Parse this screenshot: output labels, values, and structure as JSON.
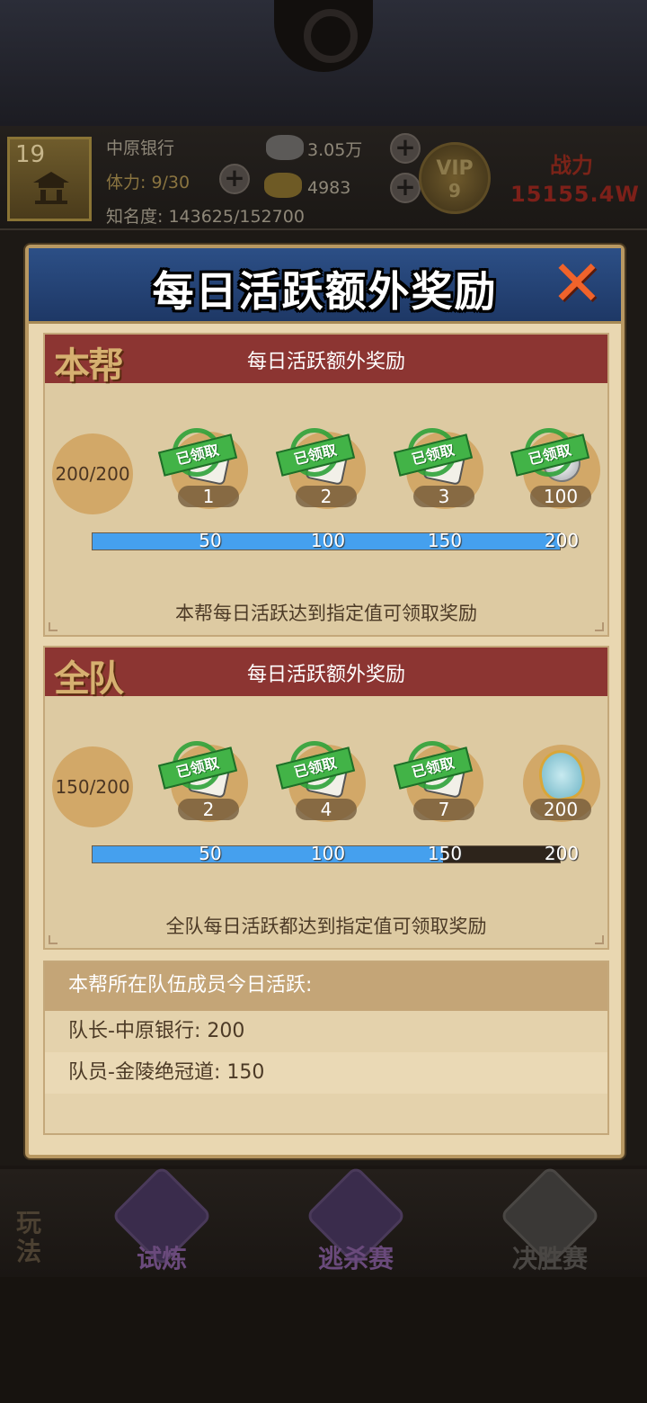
{
  "topbar": {
    "level": "19",
    "player_name": "中原银行",
    "stamina": "体力: 9/30",
    "fame": "知名度: 143625/152700",
    "silver": "3.05万",
    "gold": "4983",
    "vip_label": "VIP",
    "vip_level": "9",
    "power_label": "战力",
    "power_value": "15155.4W"
  },
  "modal": {
    "title": "每日活跃额外奖励",
    "close_icon": "close-x-icon"
  },
  "gang_panel": {
    "badge": "本帮",
    "title": "每日活跃额外奖励",
    "progress": "200/200",
    "progress_value": 200,
    "progress_max": 200,
    "rewards": [
      {
        "count": "1",
        "claimed": true,
        "stamp": "已领取"
      },
      {
        "count": "2",
        "claimed": true,
        "stamp": "已领取"
      },
      {
        "count": "3",
        "claimed": true,
        "stamp": "已领取"
      },
      {
        "count": "100",
        "claimed": true,
        "stamp": "已领取"
      }
    ],
    "ticks": [
      "50",
      "100",
      "150",
      "200"
    ],
    "note": "本帮每日活跃达到指定值可领取奖励"
  },
  "team_panel": {
    "badge": "全队",
    "title": "每日活跃额外奖励",
    "progress": "150/200",
    "progress_value": 150,
    "progress_max": 200,
    "rewards": [
      {
        "count": "2",
        "claimed": true,
        "stamp": "已领取"
      },
      {
        "count": "4",
        "claimed": true,
        "stamp": "已领取"
      },
      {
        "count": "7",
        "claimed": true,
        "stamp": "已领取"
      },
      {
        "count": "200",
        "claimed": false
      }
    ],
    "ticks": [
      "50",
      "100",
      "150",
      "200"
    ],
    "note": "全队每日活跃都达到指定值可领取奖励"
  },
  "members": {
    "header": "本帮所在队伍成员今日活跃:",
    "rows": [
      "队长-中原银行: 200",
      "队员-金陵绝冠道: 150"
    ]
  },
  "bottom_nav": {
    "side_label": "玩法",
    "items": [
      {
        "label": "试炼"
      },
      {
        "label": "逃杀赛"
      },
      {
        "label": "决胜赛"
      }
    ]
  },
  "colors": {
    "bar_fill": "#45a0ee",
    "header_red": "#8c3532",
    "modal_blue": "#2c4f86",
    "stamp_green": "#42b347"
  }
}
